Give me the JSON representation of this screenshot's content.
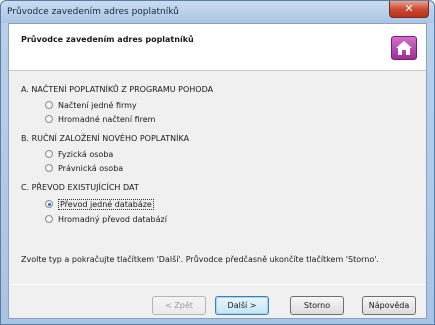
{
  "window": {
    "title": "Průvodce zavedením adres poplatníků",
    "close_glyph": "✕"
  },
  "header": {
    "title": "Průvodce zavedením adres poplatníků",
    "icon": "home-icon"
  },
  "sections": [
    {
      "title": "A. NAČTENÍ POPLATNÍKŮ Z PROGRAMU POHODA",
      "options": [
        "Načtení jedné firmy",
        "Hromadné načtení firem"
      ]
    },
    {
      "title": "B. RUČNÍ ZALOŽENÍ NOVÉHO POPLATNÍKA",
      "options": [
        "Fyzická osoba",
        "Právnická osoba"
      ]
    },
    {
      "title": "C. PŘEVOD EXISTUJÍCÍCH DAT",
      "options": [
        "Převod jedné databáze",
        "Hromadný převod databází"
      ]
    }
  ],
  "selected_option": "Převod jedné databáze",
  "instructions": "Zvolte typ a pokračujte tlačítkem 'Další'. Průvodce předčasně ukončíte tlačítkem 'Storno'.",
  "buttons": {
    "back": "< Zpět",
    "next": "Další >",
    "cancel": "Storno",
    "help": "Nápověda"
  },
  "colors": {
    "accent": "#9c2f96",
    "close": "#c9472c"
  }
}
